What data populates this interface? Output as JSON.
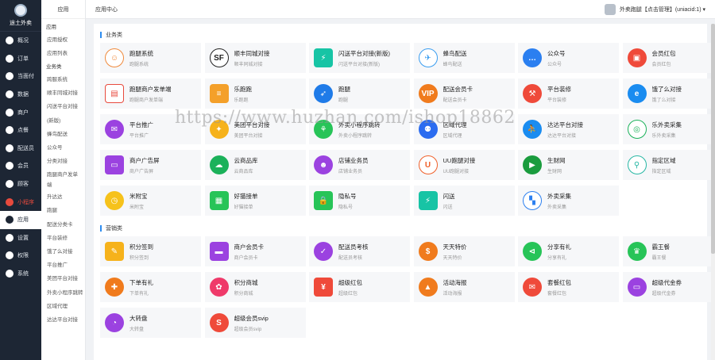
{
  "nav": {
    "logo_label": "途土外卖",
    "items": [
      {
        "label": "概况",
        "icon": "dashboard-icon"
      },
      {
        "label": "订单",
        "icon": "order-icon"
      },
      {
        "label": "当面付",
        "icon": "pay-icon"
      },
      {
        "label": "数据",
        "icon": "data-icon"
      },
      {
        "label": "商户",
        "icon": "store-icon"
      },
      {
        "label": "点餐",
        "icon": "meal-icon"
      },
      {
        "label": "配送员",
        "icon": "courier-icon"
      },
      {
        "label": "会员",
        "icon": "member-icon"
      },
      {
        "label": "顾客",
        "icon": "customer-icon"
      },
      {
        "label": "小程序",
        "icon": "miniapp-icon",
        "state": "red"
      },
      {
        "label": "应用",
        "icon": "app-icon",
        "state": "active"
      },
      {
        "label": "设置",
        "icon": "settings-icon"
      },
      {
        "label": "权限",
        "icon": "permission-icon"
      },
      {
        "label": "系统",
        "icon": "system-icon"
      }
    ]
  },
  "sub": {
    "title": "应用",
    "group1": "应用",
    "items1": [
      "应用授权",
      "应用列表"
    ],
    "group2": "业务类",
    "items2": [
      "跨服系统",
      "顺丰同城对接",
      "闪送平台对接"
    ],
    "group3": "(新版)",
    "items3": [
      "蜂鸟配送",
      "公众号",
      "分类对接"
    ],
    "tall_item": "跑腿商户发单端",
    "items4": [
      "升达达",
      "跑腿",
      "配送分类卡",
      "平台装修",
      "饿了么对接",
      "平台推广",
      "美团平台对接",
      "外卖小程序跳转",
      "区域代理",
      "达达平台对接"
    ]
  },
  "topbar": {
    "crumb": "应用中心",
    "user": "外卖跑腿【点击管理】(uniacid:1) ▾"
  },
  "section1": {
    "title": "业务类",
    "cards": [
      {
        "name": "跑腿系统",
        "desc": "跑腿系统",
        "color": "#ffffff",
        "fg": "#f08a3c",
        "glyph": "☺",
        "icon": "errand-icon"
      },
      {
        "name": "顺丰同城对接",
        "desc": "顺丰同城对接",
        "color": "#ffffff",
        "fg": "#222222",
        "glyph": "SF",
        "icon": "sf-express-icon"
      },
      {
        "name": "闪送平台对接(新版)",
        "desc": "闪送平台对接(新版)",
        "color": "#17c4a5",
        "fg": "#ffffff",
        "glyph": "⚡",
        "icon": "flash-icon",
        "sq": true
      },
      {
        "name": "蜂鸟配送",
        "desc": "蜂鸟配送",
        "color": "#ffffff",
        "fg": "#3a9df0",
        "glyph": "✈",
        "icon": "bird-icon"
      },
      {
        "name": "公众号",
        "desc": "公众号",
        "color": "#2b7ff0",
        "fg": "#ffffff",
        "glyph": "…",
        "icon": "chat-icon"
      },
      {
        "name": "会员红包",
        "desc": "会员红包",
        "color": "#ef4a3a",
        "fg": "#ffffff",
        "glyph": "▣",
        "icon": "redpacket-icon"
      },
      {
        "name": "跑腿商户发单端",
        "desc": "跑腿商户发单端",
        "color": "#ffffff",
        "fg": "#e84a3d",
        "glyph": "▤",
        "icon": "shop-order-icon",
        "sq": true
      },
      {
        "name": "乐跑跑",
        "desc": "乐跑跑",
        "color": "#f4a02a",
        "fg": "#ffffff",
        "glyph": "≡",
        "icon": "note-icon",
        "sq": true
      },
      {
        "name": "跑腿",
        "desc": "跑腿",
        "color": "#1f7be8",
        "fg": "#ffffff",
        "glyph": "➶",
        "icon": "runner-icon"
      },
      {
        "name": "配送会员卡",
        "desc": "配送会员卡",
        "color": "#f07b1d",
        "fg": "#ffffff",
        "glyph": "VIP",
        "icon": "vip-card-icon"
      },
      {
        "name": "平台装修",
        "desc": "平台装修",
        "color": "#ef4a3a",
        "fg": "#ffffff",
        "glyph": "⚒",
        "icon": "hammer-icon"
      },
      {
        "name": "饿了么对接",
        "desc": "饿了么对接",
        "color": "#1a8cf0",
        "fg": "#ffffff",
        "glyph": "e",
        "icon": "eleme-icon"
      },
      {
        "name": "平台推广",
        "desc": "平台推广",
        "color": "#9b42e0",
        "fg": "#ffffff",
        "glyph": "✉",
        "icon": "promo-icon"
      },
      {
        "name": "美团平台对接",
        "desc": "美团平台对接",
        "color": "#f6b21b",
        "fg": "#ffffff",
        "glyph": "✦",
        "icon": "meituan-icon"
      },
      {
        "name": "外卖小程序跳转",
        "desc": "外卖小程序跳转",
        "color": "#27c458",
        "fg": "#ffffff",
        "glyph": "⚘",
        "icon": "miniprogram-icon"
      },
      {
        "name": "区域代理",
        "desc": "区域代理",
        "color": "#2b6cf0",
        "fg": "#ffffff",
        "glyph": "⚉",
        "icon": "agent-icon"
      },
      {
        "name": "达达平台对接",
        "desc": "达达平台对接",
        "color": "#1a8cf0",
        "fg": "#ffffff",
        "glyph": "⛹",
        "icon": "dada-icon"
      },
      {
        "name": "乐外卖采集",
        "desc": "乐外卖采集",
        "color": "#ffffff",
        "fg": "#1bb15a",
        "glyph": "◎",
        "icon": "collect-icon"
      },
      {
        "name": "商户广告屏",
        "desc": "商户广告屏",
        "color": "#9b42e0",
        "fg": "#ffffff",
        "glyph": "▭",
        "icon": "ad-screen-icon",
        "sq": true
      },
      {
        "name": "云商品库",
        "desc": "云商品库",
        "color": "#1bb15a",
        "fg": "#ffffff",
        "glyph": "☁",
        "icon": "cloud-icon"
      },
      {
        "name": "店铺业务员",
        "desc": "店铺业务员",
        "color": "#9b42e0",
        "fg": "#ffffff",
        "glyph": "☻",
        "icon": "staff-icon"
      },
      {
        "name": "UU跑腿对接",
        "desc": "UU跑腿对接",
        "color": "#ffffff",
        "fg": "#f0602a",
        "glyph": "U",
        "icon": "uu-icon"
      },
      {
        "name": "生财网",
        "desc": "生财网",
        "color": "#1a9c3e",
        "fg": "#ffffff",
        "glyph": "▶",
        "icon": "play-icon"
      },
      {
        "name": "指定区域",
        "desc": "指定区域",
        "color": "#ffffff",
        "fg": "#27b7a4",
        "glyph": "⚲",
        "icon": "location-icon"
      },
      {
        "name": "米附宝",
        "desc": "米附宝",
        "color": "#f6c21b",
        "fg": "#ffffff",
        "glyph": "◷",
        "icon": "clock-icon"
      },
      {
        "name": "好猫接单",
        "desc": "好猫接单",
        "color": "#27c458",
        "fg": "#ffffff",
        "glyph": "▦",
        "icon": "ticket-icon",
        "sq": true
      },
      {
        "name": "隐私号",
        "desc": "隐私号",
        "color": "#27c458",
        "fg": "#ffffff",
        "glyph": "🔒",
        "icon": "lock-icon",
        "sq": true
      },
      {
        "name": "闪送",
        "desc": "闪送",
        "color": "#17c4a5",
        "fg": "#ffffff",
        "glyph": "⚡",
        "icon": "flash-icon",
        "sq": true
      },
      {
        "name": "外卖采集",
        "desc": "外卖采集",
        "color": "#ffffff",
        "fg": "#2b7ff0",
        "glyph": "▚",
        "icon": "grid-icon"
      }
    ]
  },
  "section2": {
    "title": "营销类",
    "cards": [
      {
        "name": "积分签到",
        "desc": "积分签到",
        "color": "#f6b21b",
        "fg": "#ffffff",
        "glyph": "✎",
        "icon": "checkin-icon",
        "sq": true
      },
      {
        "name": "商户会员卡",
        "desc": "商户会员卡",
        "color": "#9b42e0",
        "fg": "#ffffff",
        "glyph": "▬",
        "icon": "member-card-icon",
        "sq": true
      },
      {
        "name": "配送员考核",
        "desc": "配送员考核",
        "color": "#9b42e0",
        "fg": "#ffffff",
        "glyph": "✓",
        "icon": "exam-icon"
      },
      {
        "name": "天天特价",
        "desc": "天天特价",
        "color": "#f07b1d",
        "fg": "#ffffff",
        "glyph": "$",
        "icon": "price-icon"
      },
      {
        "name": "分享有礼",
        "desc": "分享有礼",
        "color": "#27c458",
        "fg": "#ffffff",
        "glyph": "⊲",
        "icon": "share-icon"
      },
      {
        "name": "霸王餐",
        "desc": "霸王餐",
        "color": "#27c458",
        "fg": "#ffffff",
        "glyph": "♛",
        "icon": "crown-icon"
      },
      {
        "name": "下单有礼",
        "desc": "下单有礼",
        "color": "#f07b1d",
        "fg": "#ffffff",
        "glyph": "✚",
        "icon": "gift-icon"
      },
      {
        "name": "积分商城",
        "desc": "积分商城",
        "color": "#ef3a6a",
        "fg": "#ffffff",
        "glyph": "✿",
        "icon": "mall-icon"
      },
      {
        "name": "超级红包",
        "desc": "超级红包",
        "color": "#ef4a3a",
        "fg": "#ffffff",
        "glyph": "¥",
        "icon": "super-redpacket-icon",
        "sq": true
      },
      {
        "name": "活动海报",
        "desc": "活动海报",
        "color": "#f07b1d",
        "fg": "#ffffff",
        "glyph": "▲",
        "icon": "poster-icon"
      },
      {
        "name": "套餐红包",
        "desc": "套餐红包",
        "color": "#ef4a3a",
        "fg": "#ffffff",
        "glyph": "✉",
        "icon": "combo-icon"
      },
      {
        "name": "超级代金券",
        "desc": "超级代金券",
        "color": "#9b42e0",
        "fg": "#ffffff",
        "glyph": "▭",
        "icon": "coupon-icon"
      },
      {
        "name": "大转盘",
        "desc": "大转盘",
        "color": "#9b42e0",
        "fg": "#ffffff",
        "glyph": "◔",
        "icon": "wheel-icon"
      },
      {
        "name": "超级会员svip",
        "desc": "超级会员svip",
        "color": "#ef4a3a",
        "fg": "#ffffff",
        "glyph": "S",
        "icon": "svip-icon"
      }
    ]
  },
  "watermark": "https://www.huzhan.com/ishop18862"
}
